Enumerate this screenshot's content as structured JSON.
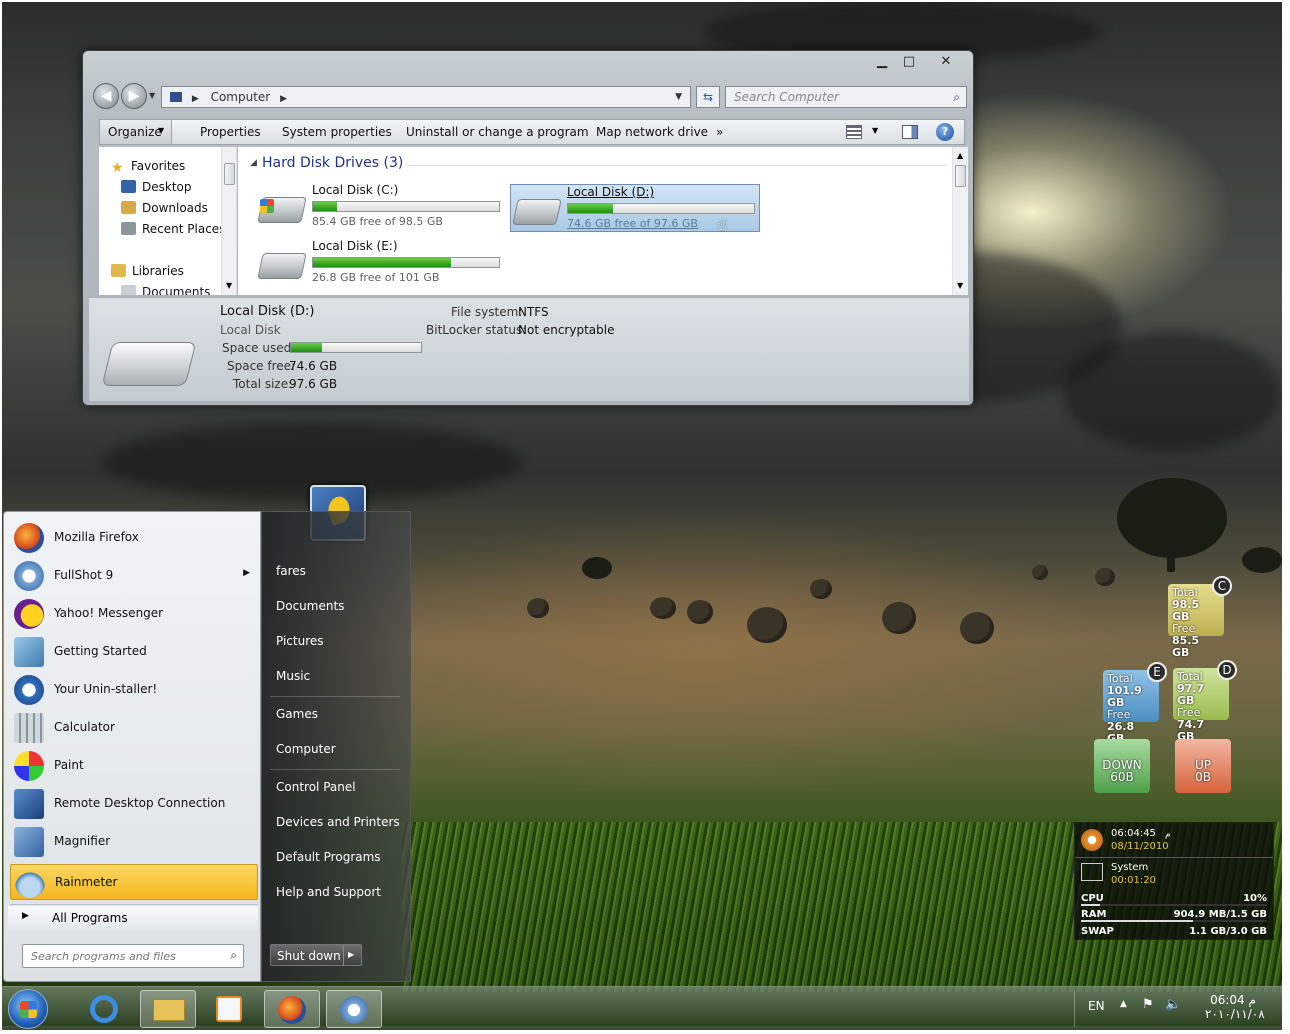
{
  "explorer": {
    "breadcrumb": "Computer",
    "search_placeholder": "Search Computer",
    "commands": [
      "Organize",
      "Properties",
      "System properties",
      "Uninstall or change a program",
      "Map network drive",
      "»"
    ],
    "nav": {
      "favorites": "Favorites",
      "desktop": "Desktop",
      "downloads": "Downloads",
      "recent": "Recent Places",
      "libraries": "Libraries",
      "documents": "Documents"
    },
    "group_title": "Hard Disk Drives (3)",
    "drives": [
      {
        "name": "Local Disk (C:)",
        "free": "85.4 GB free of 98.5 GB",
        "used_fraction": 0.13
      },
      {
        "name": "Local Disk (D:)",
        "free": "74.6 GB free of 97.6 GB",
        "used_fraction": 0.24
      },
      {
        "name": "Local Disk (E:)",
        "free": "26.8 GB free of 101 GB",
        "used_fraction": 0.74
      }
    ],
    "details": {
      "name": "Local Disk (D:)",
      "type": "Local Disk",
      "space_used_label": "Space used:",
      "space_free_label": "Space free:",
      "space_free": "74.6 GB",
      "total_label": "Total size:",
      "total": "97.6 GB",
      "fs_label": "File system:",
      "fs": "NTFS",
      "bitlocker_label": "BitLocker status:",
      "bitlocker": "Not encryptable",
      "used_fraction": 0.24
    }
  },
  "startmenu": {
    "programs": [
      "Mozilla Firefox",
      "FullShot 9",
      "Yahoo! Messenger",
      "Getting Started",
      "Your Unin-staller!",
      "Calculator",
      "Paint",
      "Remote Desktop Connection",
      "Magnifier",
      "Rainmeter"
    ],
    "all_programs": "All Programs",
    "search_placeholder": "Search programs and files",
    "user": "fares",
    "links": [
      "Documents",
      "Pictures",
      "Music",
      "Games",
      "Computer",
      "Control Panel",
      "Devices and Printers",
      "Default Programs",
      "Help and Support"
    ],
    "shutdown": "Shut down"
  },
  "gadgets": {
    "c": {
      "letter": "C",
      "total_label": "Total",
      "total": "98.5 GB",
      "free_label": "Free",
      "free": "85.5 GB"
    },
    "e": {
      "letter": "E",
      "total_label": "Total",
      "total": "101.9 GB",
      "free_label": "Free",
      "free": "26.8 GB"
    },
    "d": {
      "letter": "D",
      "total_label": "Total",
      "total": "97.7 GB",
      "free_label": "Free",
      "free": "74.7 GB"
    },
    "down": {
      "label": "DOWN",
      "value": "60B"
    },
    "up": {
      "label": "UP",
      "value": "0B"
    },
    "clock": {
      "time": "06:04:45",
      "ampm": "م",
      "date": "08/11/2010"
    },
    "system": {
      "title": "System",
      "uptime": "00:01:20",
      "cpu_label": "CPU",
      "cpu": "10%",
      "ram_label": "RAM",
      "ram": "904.9 MB/1.5 GB",
      "swap_label": "SWAP",
      "swap": "1.1 GB/3.0 GB"
    }
  },
  "taskbar": {
    "lang": "EN",
    "time": "06:04 م",
    "date": "٢٠١٠/١١/٠٨"
  },
  "colors": {
    "progress": "#1f8d12",
    "rainmeter_highlight": "#f4c236",
    "selection": "#a9c9e5"
  }
}
